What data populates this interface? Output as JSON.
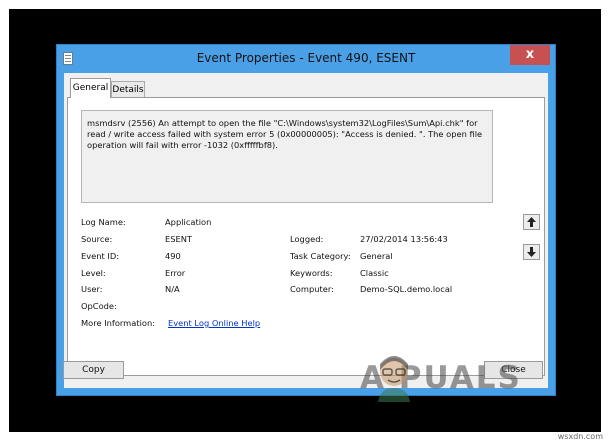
{
  "window": {
    "title": "Event Properties - Event 490, ESENT",
    "close_glyph": "x"
  },
  "tabs": [
    {
      "label": "General",
      "active": true
    },
    {
      "label": "Details",
      "active": false
    }
  ],
  "description": "msmdsrv (2556) An attempt to open the file \"C:\\Windows\\system32\\LogFiles\\Sum\\Api.chk\" for read / write access failed with system error 5 (0x00000005): \"Access is denied. \".  The open file operation will fail with error -1032 (0xfffffbf8).",
  "fields": {
    "log_name": {
      "label": "Log Name:",
      "value": "Application"
    },
    "source": {
      "label": "Source:",
      "value": "ESENT"
    },
    "event_id": {
      "label": "Event ID:",
      "value": "490"
    },
    "level": {
      "label": "Level:",
      "value": "Error"
    },
    "user": {
      "label": "User:",
      "value": "N/A"
    },
    "opcode": {
      "label": "OpCode:",
      "value": ""
    },
    "more_info": {
      "label": "More Information:",
      "value": "Event Log Online Help"
    },
    "logged": {
      "label": "Logged:",
      "value": "27/02/2014 13:56:43"
    },
    "task_category": {
      "label": "Task Category:",
      "value": "General"
    },
    "keywords": {
      "label": "Keywords:",
      "value": "Classic"
    },
    "computer": {
      "label": "Computer:",
      "value": "Demo-SQL.demo.local"
    }
  },
  "buttons": {
    "copy": "Copy",
    "close": "Close"
  },
  "watermark": "A  PUALS",
  "source_tag": "wsxdn.com",
  "colors": {
    "title_bar": "#4aa0e6",
    "close_button": "#c75050",
    "link": "#0033cc"
  }
}
